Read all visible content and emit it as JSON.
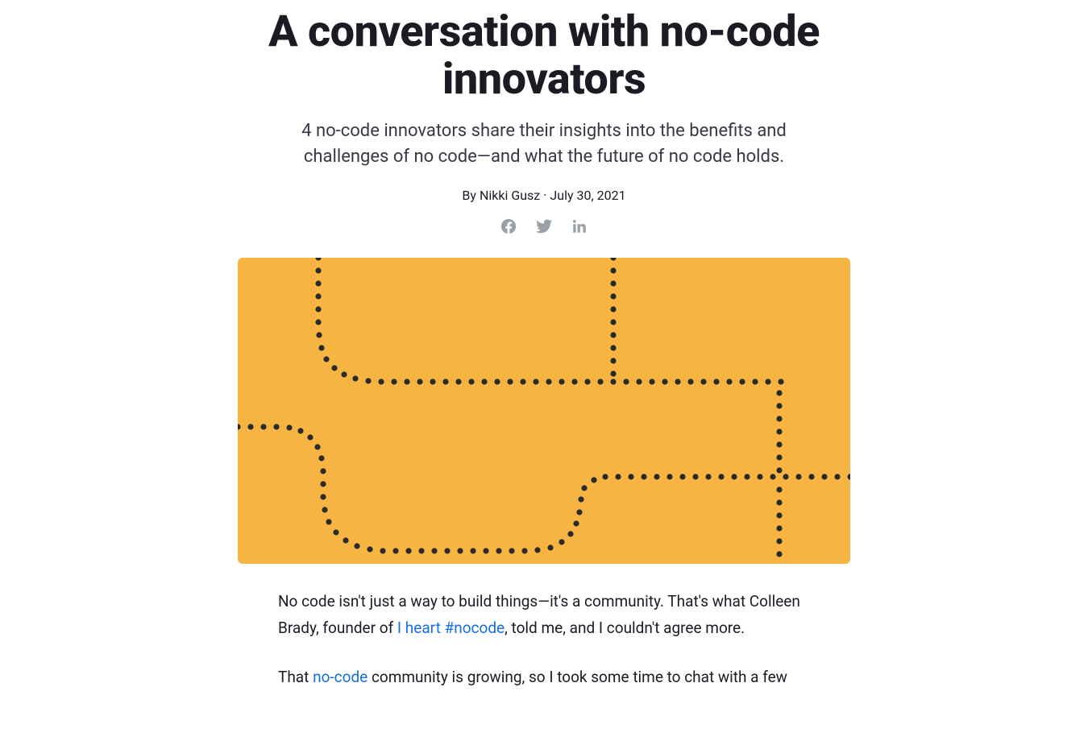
{
  "article": {
    "title": "A conversation with no-code innovators",
    "subtitle": "4 no-code innovators share their insights into the benefits and challenges of no code—and what the future of no code holds.",
    "byline_prefix": "By ",
    "author": "Nikki Gusz",
    "date": "July 30, 2021"
  },
  "share": {
    "facebook": "facebook",
    "twitter": "twitter",
    "linkedin": "linkedin"
  },
  "body": {
    "p1a": "No code isn't just a way to build things—it's a community. That's what Colleen Brady, founder of ",
    "p1_link": "I heart #nocode",
    "p1b": ", told me, and I couldn't agree more.",
    "p2a": "That ",
    "p2_link": "no-code",
    "p2b": " community is growing, so I took some time to chat with a few"
  }
}
